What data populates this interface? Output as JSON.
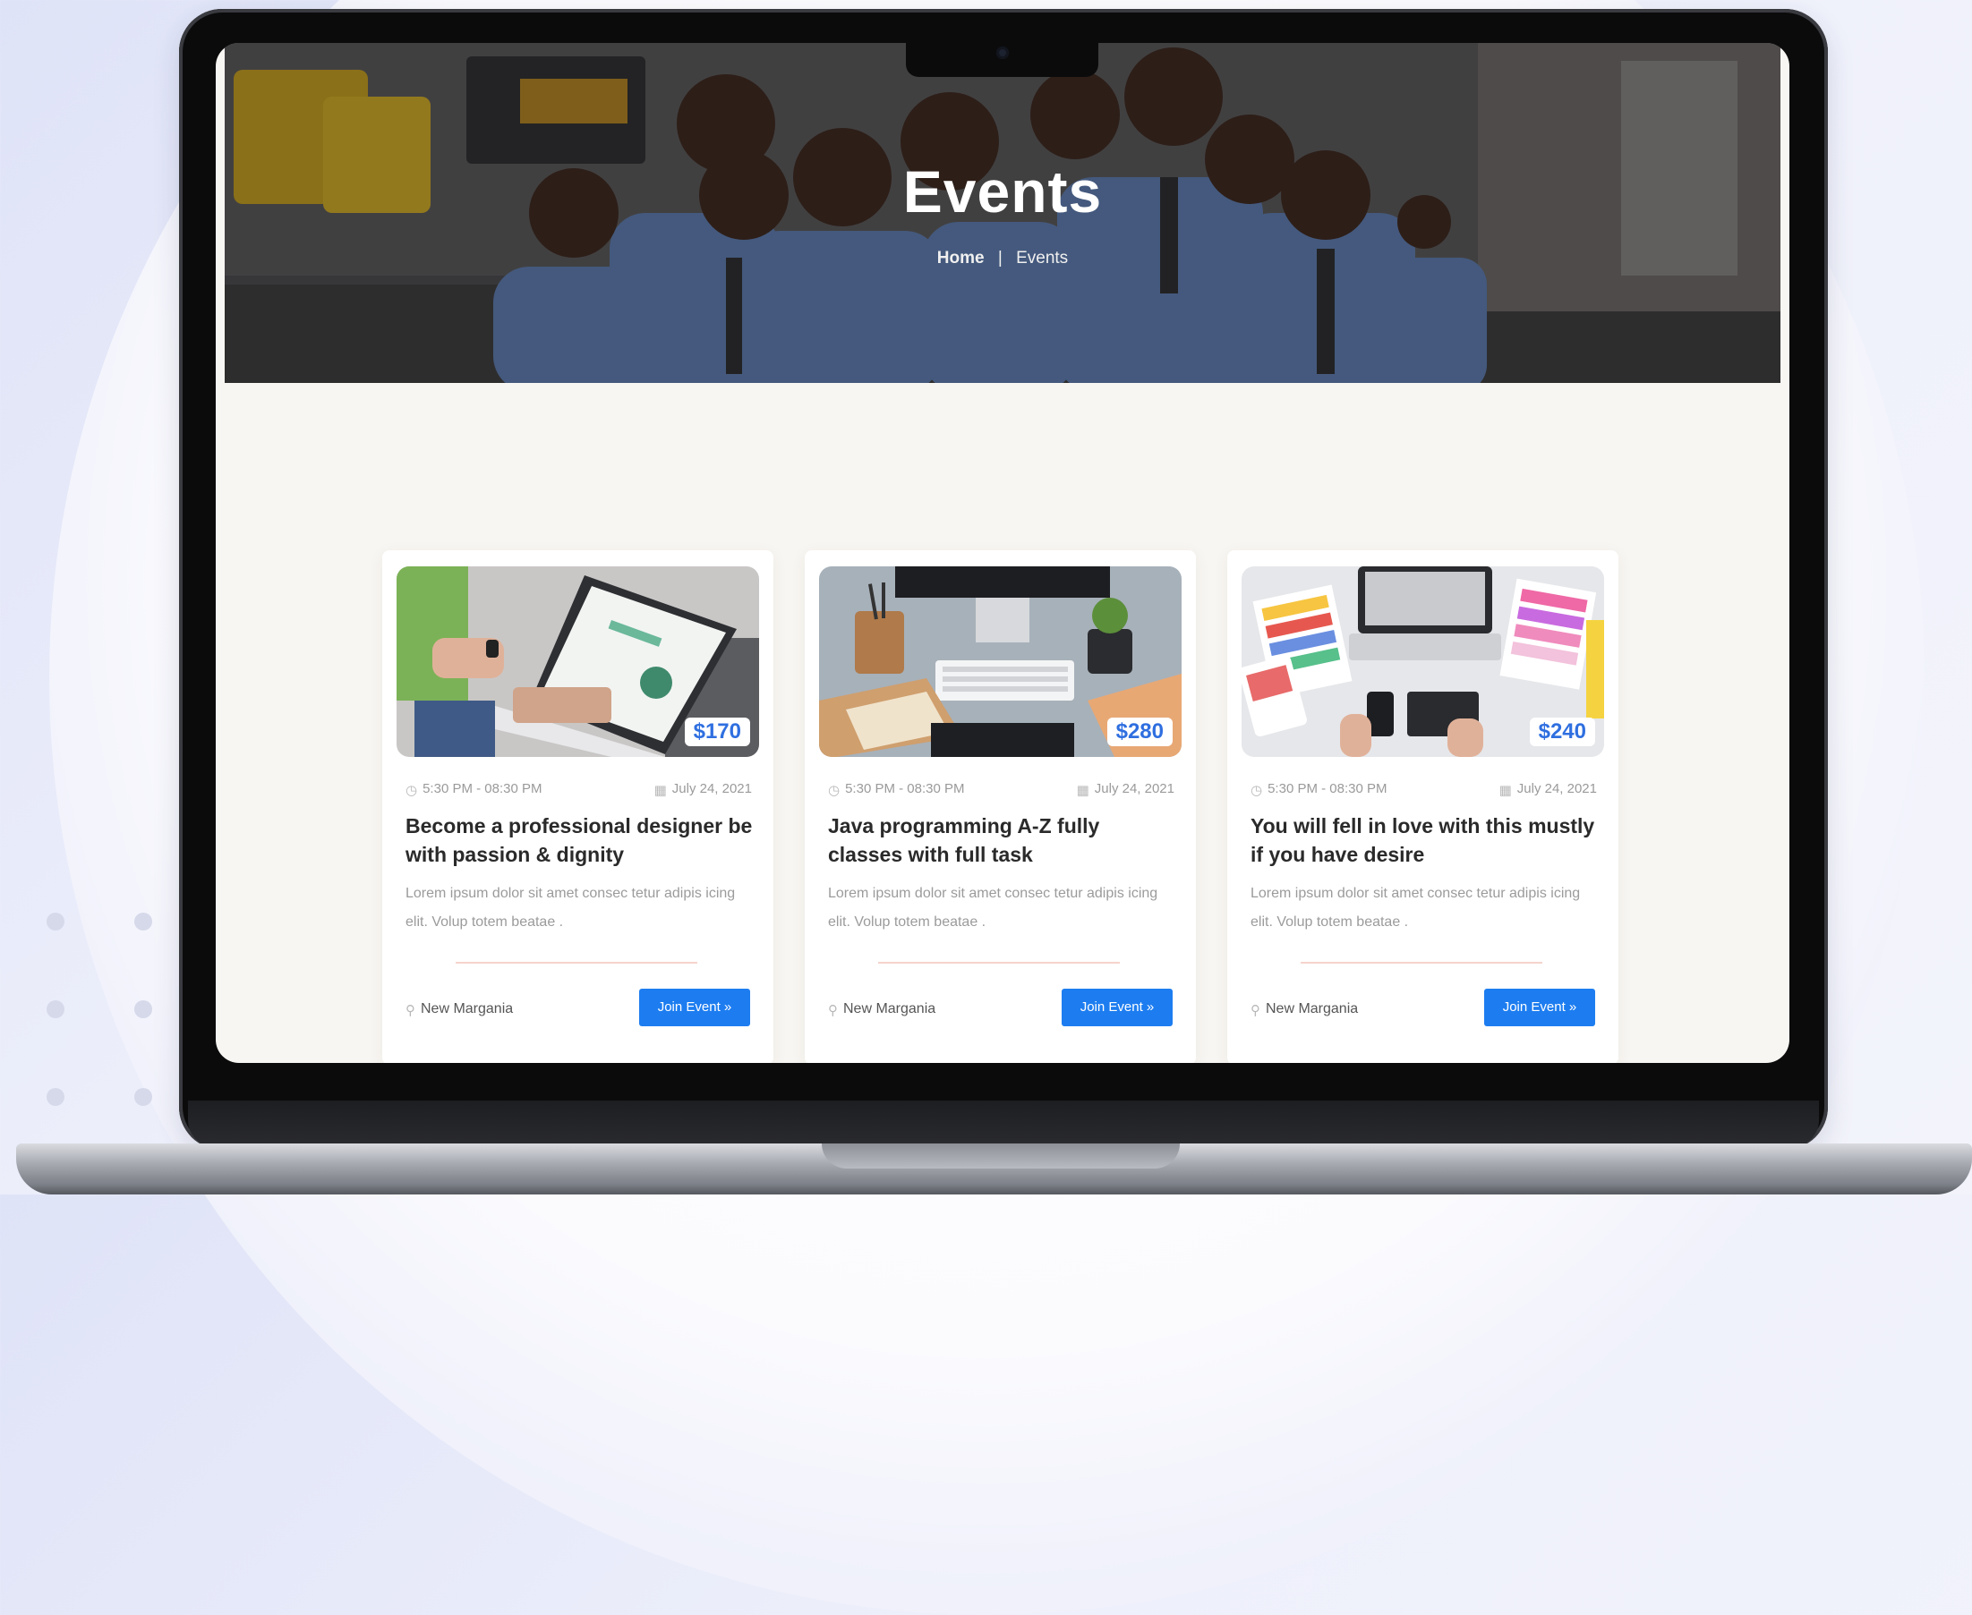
{
  "hero": {
    "title": "Events",
    "breadcrumb": {
      "home": "Home",
      "separator": "|",
      "current": "Events"
    }
  },
  "events": [
    {
      "price": "$170",
      "time": "5:30 PM - 08:30 PM",
      "date": "July 24, 2021",
      "title": "Become a professional designer be with passion & dignity",
      "description": "Lorem ipsum dolor sit amet consec tetur adipis icing elit. Volup totem beatae .",
      "location": "New Margania",
      "button_label": "Join Event »",
      "image": "laptop-design-photo"
    },
    {
      "price": "$280",
      "time": "5:30 PM - 08:30 PM",
      "date": "July 24, 2021",
      "title": "Java programming A-Z fully classes with full task",
      "description": "Lorem ipsum dolor sit amet consec tetur adipis icing elit. Volup totem beatae .",
      "location": "New Margania",
      "button_label": "Join Event »",
      "image": "desk-workspace-photo"
    },
    {
      "price": "$240",
      "time": "5:30 PM - 08:30 PM",
      "date": "July 24, 2021",
      "title": "You will fell in love with this mustly if you have desire",
      "description": "Lorem ipsum dolor sit amet consec tetur adipis icing elit. Volup totem beatae .",
      "location": "New Margania",
      "button_label": "Join Event »",
      "image": "color-swatches-photo"
    }
  ],
  "icons": {
    "time": "clock-icon",
    "date": "calendar-icon",
    "location": "map-pin-icon"
  },
  "colors": {
    "accent": "#1d7df0",
    "price_text": "#2f6fe0",
    "screen_background": "#f8f6f2"
  }
}
